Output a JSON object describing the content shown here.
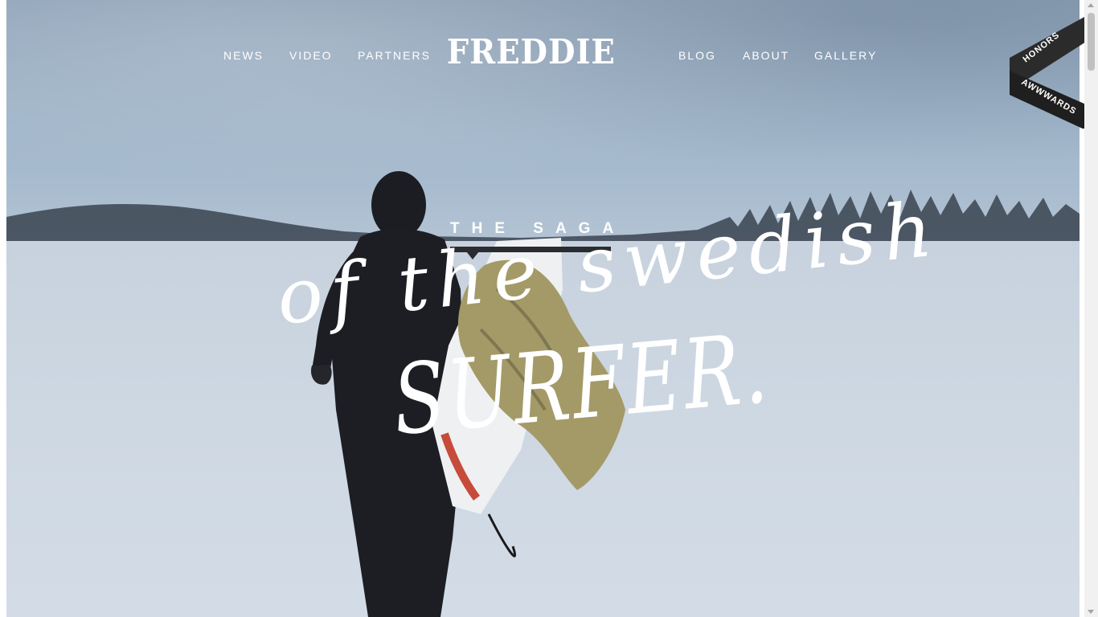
{
  "nav": {
    "left": [
      "NEWS",
      "VIDEO",
      "PARTNERS"
    ],
    "logo": "FREDDIE",
    "right": [
      "BLOG",
      "ABOUT",
      "GALLERY"
    ]
  },
  "hero": {
    "kicker": "THE SAGA",
    "script_line1": "of the swedish",
    "script_line2": "SURFER."
  },
  "badge": {
    "top_text": "HONORS",
    "bottom_text": "AWWWARDS",
    "accent_color": "#49c5b6"
  },
  "colors": {
    "text": "#ffffff",
    "kicker_bar": "#2a2c30",
    "badge_dark": "#2b2b2b"
  }
}
